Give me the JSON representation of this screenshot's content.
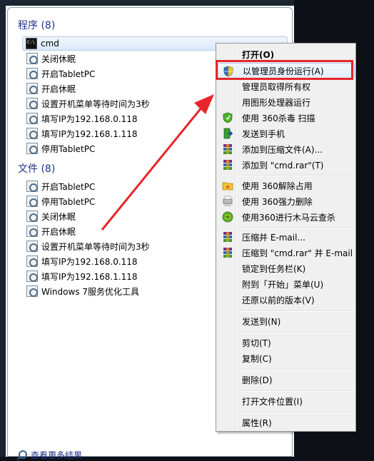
{
  "programs_section": {
    "title": "程序 (8)",
    "items": [
      {
        "label": "cmd",
        "icon": "cmd-icon"
      },
      {
        "label": "关闭休眠",
        "icon": "gear-icon"
      },
      {
        "label": "开启TabletPC",
        "icon": "gear-icon"
      },
      {
        "label": "开启休眠",
        "icon": "gear-icon"
      },
      {
        "label": "设置开机菜单等待时间为3秒",
        "icon": "gear-icon"
      },
      {
        "label": "填写IP为192.168.0.118",
        "icon": "gear-icon"
      },
      {
        "label": "填写IP为192.168.1.118",
        "icon": "gear-icon"
      },
      {
        "label": "停用TabletPC",
        "icon": "gear-icon"
      }
    ]
  },
  "files_section": {
    "title": "文件 (8)",
    "items": [
      {
        "label": "开启TabletPC",
        "icon": "gear-icon"
      },
      {
        "label": "停用TabletPC",
        "icon": "gear-icon"
      },
      {
        "label": "关闭休眠",
        "icon": "gear-icon"
      },
      {
        "label": "开启休眠",
        "icon": "gear-icon"
      },
      {
        "label": "设置开机菜单等待时间为3秒",
        "icon": "gear-icon"
      },
      {
        "label": "填写IP为192.168.0.118",
        "icon": "gear-icon"
      },
      {
        "label": "填写IP为192.168.1.118",
        "icon": "gear-icon"
      },
      {
        "label": "Windows 7服务优化工具",
        "icon": "gear-icon"
      }
    ]
  },
  "see_more": {
    "label": "查看更多结果",
    "icon": "search-icon"
  },
  "context_menu": {
    "items": [
      {
        "label": "打开(O)",
        "bold": true,
        "icon": ""
      },
      {
        "label": "以管理员身份运行(A)",
        "icon": "uac-shield-icon",
        "highlight": true
      },
      {
        "label": "管理员取得所有权",
        "icon": ""
      },
      {
        "label": "用图形处理器运行",
        "icon": ""
      },
      {
        "label": "使用 360杀毒 扫描",
        "icon": "360-shield-icon"
      },
      {
        "label": "发送到手机",
        "icon": "phone-send-icon"
      },
      {
        "label": "添加到压缩文件(A)...",
        "icon": "winrar-icon"
      },
      {
        "label": "添加到 \"cmd.rar\"(T)",
        "icon": "winrar-icon"
      },
      {
        "label": "使用 360解除占用",
        "icon": "folder-unlock-icon"
      },
      {
        "label": "使用 360强力删除",
        "icon": "shredder-icon"
      },
      {
        "label": "使用360进行木马云查杀",
        "icon": "360-plus-icon"
      },
      {
        "label": "压缩并 E-mail...",
        "icon": "winrar-icon"
      },
      {
        "label": "压缩到 \"cmd.rar\" 并 E-mail",
        "icon": "winrar-icon"
      },
      {
        "label": "锁定到任务栏(K)",
        "icon": ""
      },
      {
        "label": "附到「开始」菜单(U)",
        "icon": ""
      },
      {
        "label": "还原以前的版本(V)",
        "icon": ""
      },
      {
        "label": "发送到(N)",
        "icon": ""
      },
      {
        "label": "剪切(T)",
        "icon": ""
      },
      {
        "label": "复制(C)",
        "icon": ""
      },
      {
        "label": "删除(D)",
        "icon": ""
      },
      {
        "label": "打开文件位置(I)",
        "icon": ""
      },
      {
        "label": "属性(R)",
        "icon": ""
      }
    ]
  },
  "colors": {
    "annotation_red": "#e8252a",
    "section_title_blue": "#1e3287",
    "menu_background": "#f0f0f0"
  }
}
